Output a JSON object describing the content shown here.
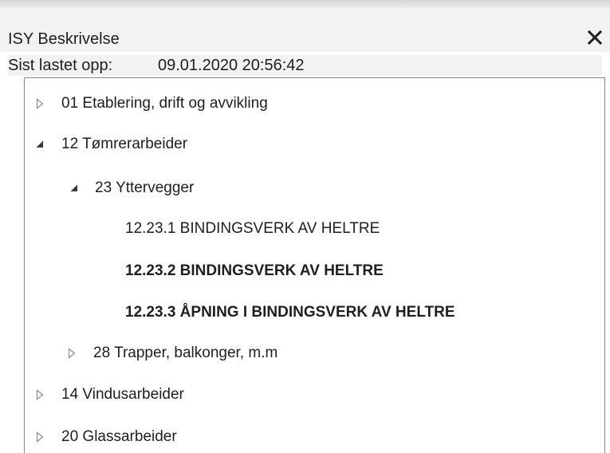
{
  "window": {
    "title": "ISY Beskrivelse",
    "close_icon": "close-icon"
  },
  "upload": {
    "label": "Sist lastet opp:",
    "value": "09.01.2020 20:56:42"
  },
  "tree": {
    "items": [
      {
        "label": "01 Etablering, drift og avvikling",
        "level": 0,
        "state": "collapsed",
        "bold": false
      },
      {
        "label": "12 Tømrerarbeider",
        "level": 0,
        "state": "expanded",
        "bold": false
      },
      {
        "label": "23 Yttervegger",
        "level": 1,
        "state": "expanded",
        "bold": false
      },
      {
        "label": "12.23.1 BINDINGSVERK AV HELTRE",
        "level": 2,
        "state": "leaf",
        "bold": false
      },
      {
        "label": "12.23.2 BINDINGSVERK AV HELTRE",
        "level": 2,
        "state": "leaf",
        "bold": true
      },
      {
        "label": "12.23.3 ÅPNING I BINDINGSVERK AV HELTRE",
        "level": 2,
        "state": "leaf",
        "bold": true
      },
      {
        "label": "28 Trapper, balkonger, m.m",
        "level": 1,
        "state": "collapsed",
        "bold": false
      },
      {
        "label": "14 Vindusarbeider",
        "level": 0,
        "state": "collapsed",
        "bold": false
      },
      {
        "label": "20 Glassarbeider",
        "level": 0,
        "state": "collapsed",
        "bold": false
      }
    ]
  }
}
